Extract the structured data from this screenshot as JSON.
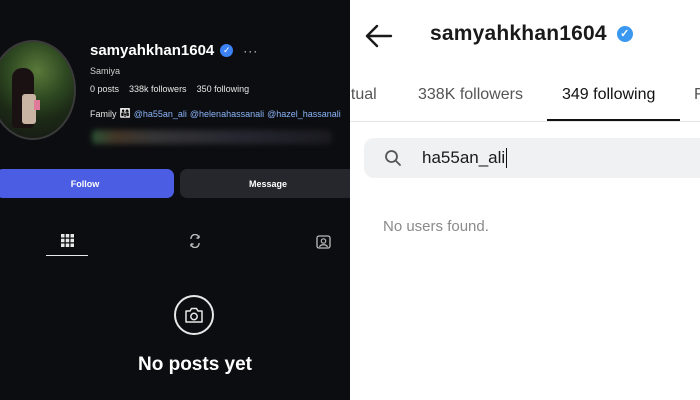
{
  "left_profile": {
    "username": "samyahkhan1604",
    "more_menu": "···",
    "full_name": "Samiya",
    "stats": {
      "posts": "0 posts",
      "followers": "338k followers",
      "following": "350 following"
    },
    "bio": {
      "label": "Family",
      "emoji": "👨‍👩‍👧",
      "mentions": [
        "@ha55an_ali",
        "@helenahassanali",
        "@hazel_hassanali"
      ]
    },
    "buttons": {
      "follow": "Follow",
      "message": "Message"
    },
    "tabs": {
      "grid_icon": "grid-icon",
      "reels_icon": "reels-icon",
      "tagged_icon": "tagged-icon"
    },
    "empty_state": {
      "icon": "camera-icon",
      "text": "No posts yet"
    },
    "colors": {
      "background": "#0c0d10",
      "follow_button": "#4a5de3",
      "message_button": "#25272c",
      "mention": "#8ab4f8",
      "verified": "#3b82f6"
    }
  },
  "right_following": {
    "back_icon": "arrow-left-icon",
    "username": "samyahkhan1604",
    "verified_icon": "verified-badge-icon",
    "tabs": [
      {
        "label": "utual"
      },
      {
        "label": "338K followers"
      },
      {
        "label": "349 following",
        "active": true
      },
      {
        "label": "F"
      }
    ],
    "search": {
      "value": "ha55an_ali",
      "icon": "search-icon"
    },
    "empty_message": "No users found.",
    "colors": {
      "background": "#ffffff",
      "search_bg": "#f0f1f2",
      "verified": "#3b98f0"
    }
  }
}
